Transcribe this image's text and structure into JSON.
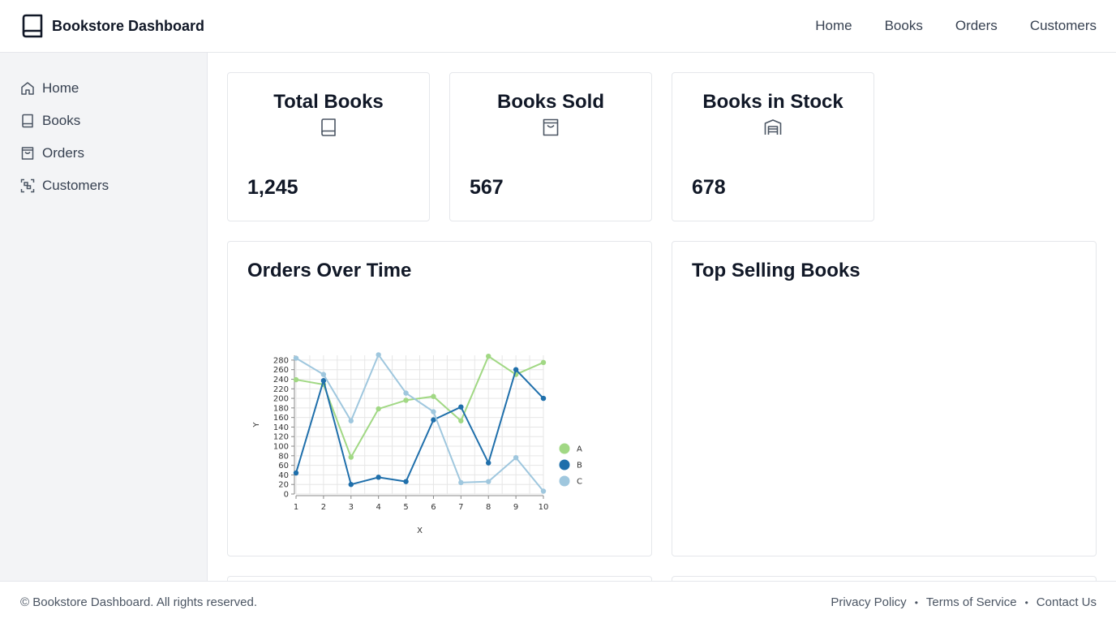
{
  "header": {
    "title": "Bookstore Dashboard",
    "nav": [
      "Home",
      "Books",
      "Orders",
      "Customers"
    ]
  },
  "sidebar": {
    "items": [
      {
        "label": "Home",
        "icon": "home-icon"
      },
      {
        "label": "Books",
        "icon": "book-icon"
      },
      {
        "label": "Orders",
        "icon": "shopping-bag-icon"
      },
      {
        "label": "Customers",
        "icon": "customers-icon"
      }
    ]
  },
  "stats": [
    {
      "title": "Total Books",
      "value": "1,245",
      "icon": "book-icon"
    },
    {
      "title": "Books Sold",
      "value": "567",
      "icon": "shopping-bag-icon"
    },
    {
      "title": "Books in Stock",
      "value": "678",
      "icon": "warehouse-icon"
    }
  ],
  "panels": {
    "orders_title": "Orders Over Time",
    "top_selling_title": "Top Selling Books"
  },
  "footer": {
    "copyright": "© Bookstore Dashboard. All rights reserved.",
    "links": [
      "Privacy Policy",
      "Terms of Service",
      "Contact Us"
    ]
  },
  "chart_data": {
    "type": "line",
    "x": [
      1,
      2,
      3,
      4,
      5,
      6,
      7,
      8,
      9,
      10
    ],
    "xlabel": "X",
    "ylabel": "Y",
    "ylim": [
      0,
      280
    ],
    "yticks": [
      0,
      20,
      40,
      60,
      80,
      100,
      120,
      140,
      160,
      180,
      200,
      220,
      240,
      260,
      280
    ],
    "legend_position": "right",
    "grid": true,
    "series": [
      {
        "name": "A",
        "color": "#a1d884",
        "values": [
          239,
          229,
          77,
          178,
          196,
          204,
          153,
          288,
          250,
          275
        ]
      },
      {
        "name": "B",
        "color": "#1f6fab",
        "values": [
          44,
          237,
          20,
          35,
          26,
          155,
          182,
          65,
          260,
          200
        ]
      },
      {
        "name": "C",
        "color": "#9fc7de",
        "values": [
          284,
          250,
          153,
          291,
          211,
          172,
          24,
          26,
          76,
          6
        ]
      }
    ]
  }
}
